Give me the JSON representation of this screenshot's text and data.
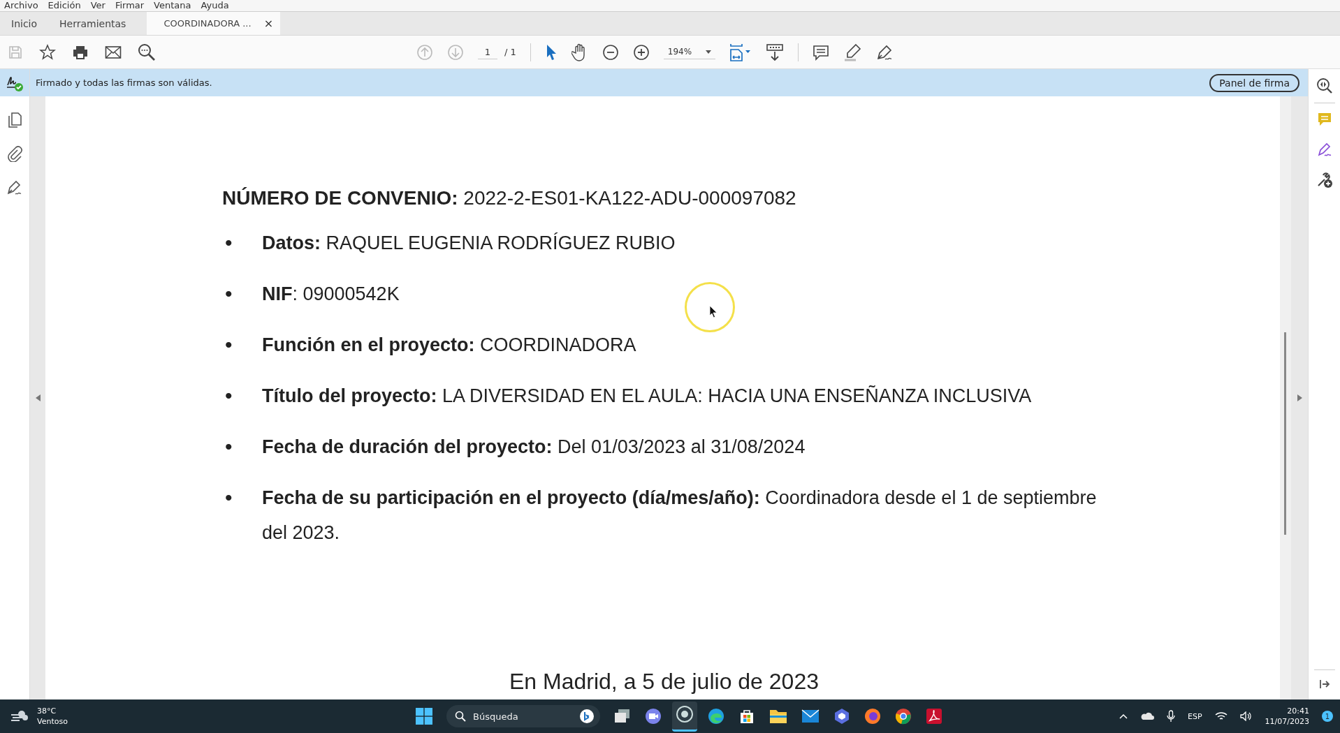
{
  "menu_bar": [
    "Archivo",
    "Edición",
    "Ver",
    "Firmar",
    "Ventana",
    "Ayuda"
  ],
  "tabs": [
    {
      "label": "Inicio",
      "selected": false
    },
    {
      "label": "Herramientas",
      "selected": false
    },
    {
      "label": "COORDINADORA ...",
      "selected": true
    }
  ],
  "close_glyph": "×",
  "toolbar": {
    "page": "1",
    "page_total": "/ 1",
    "zoom": "194%"
  },
  "signature_bar": {
    "message": "Firmado y todas las firmas son válidas.",
    "button": "Panel de firma"
  },
  "document": {
    "heading": "**NÚMERO DE CONVENIO:** 2022-2-ES01-KA122-ADU-000097082",
    "bullet": "•",
    "items": [
      "**Datos:** RAQUEL EUGENIA RODRÍGUEZ RUBIO",
      "**NIF**: 09000542K",
      "**Función en el proyecto:** COORDINADORA",
      "**Título del proyecto:** LA DIVERSIDAD EN EL AULA: HACIA UNA ENSEÑANZA INCLUSIVA",
      "**Fecha de duración del proyecto:** Del 01/03/2023 al 31/08/2024",
      "**Fecha de su participación en el proyecto (día/mes/año):** Coordinadora desde el 1 de septiembre del 2023."
    ],
    "closing": "En Madrid, a 5 de julio de 2023"
  },
  "taskbar": {
    "temperature": "38°C",
    "weather": "Ventoso",
    "search_placeholder": "Búsqueda",
    "language": "ESP",
    "time": "20:41",
    "date": "11/07/2023",
    "notifications": "1"
  }
}
